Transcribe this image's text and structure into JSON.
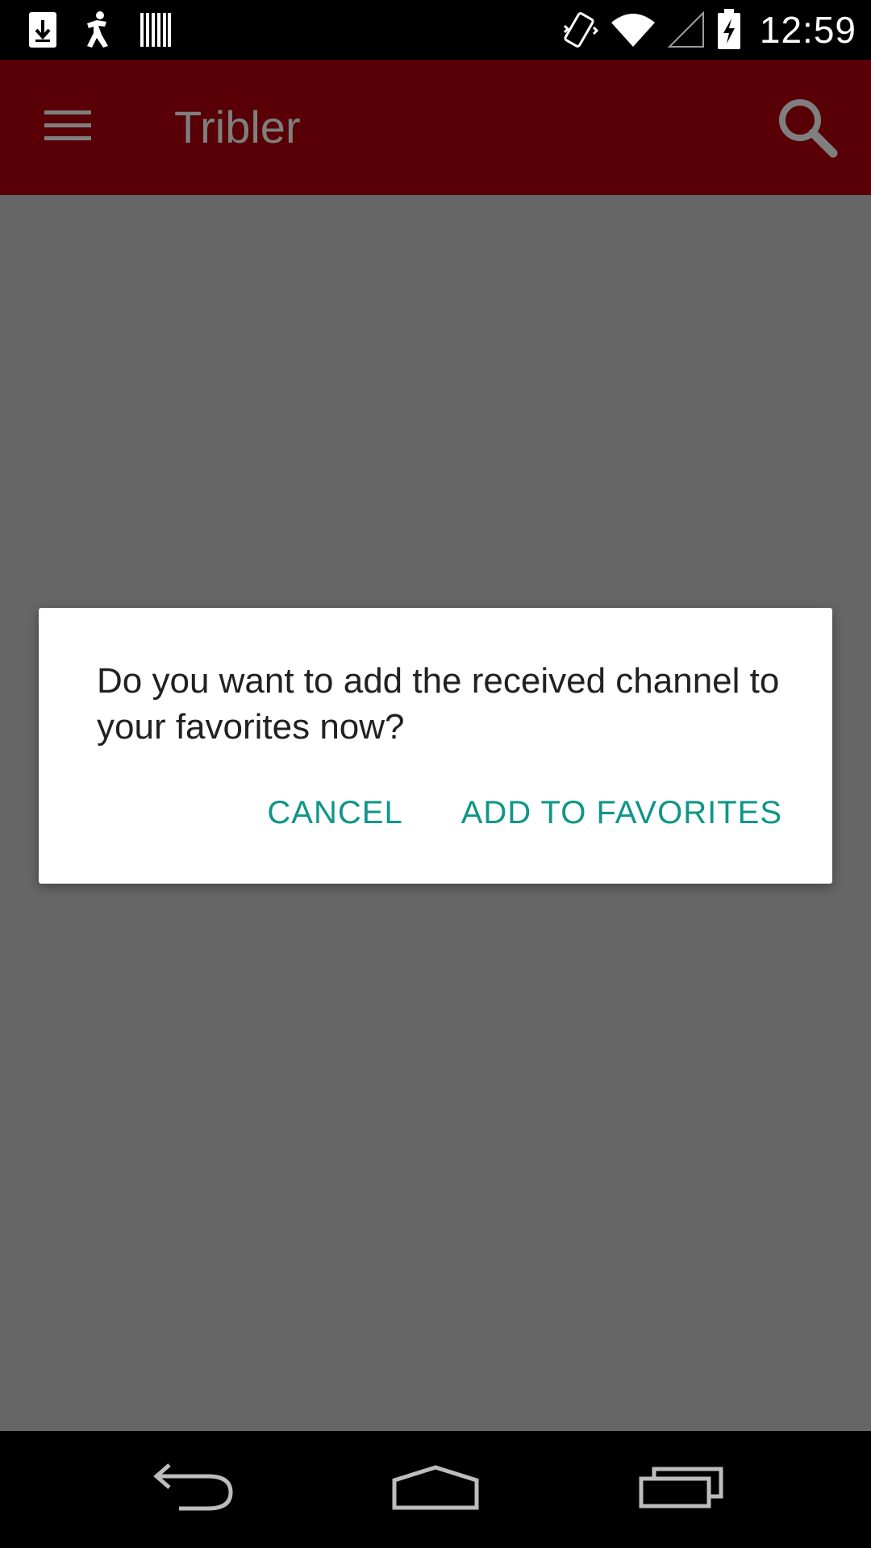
{
  "status_bar": {
    "time": "12:59",
    "left_icons": [
      "download-icon",
      "walking-person-icon",
      "barcode-icon"
    ],
    "right_icons": [
      "vibrate-icon",
      "wifi-icon",
      "signal-icon",
      "battery-charging-icon"
    ]
  },
  "app_bar": {
    "title": "Tribler",
    "background_color": "#580006",
    "menu_icon": "menu-icon",
    "search_icon": "search-icon"
  },
  "dialog": {
    "message": "Do you want to add the received channel to your favorites now?",
    "cancel_label": "CANCEL",
    "confirm_label": "ADD TO FAVORITES",
    "accent_color": "#0f9688"
  },
  "nav_bar": {
    "icons": [
      "back-icon",
      "home-icon",
      "recents-icon"
    ]
  }
}
